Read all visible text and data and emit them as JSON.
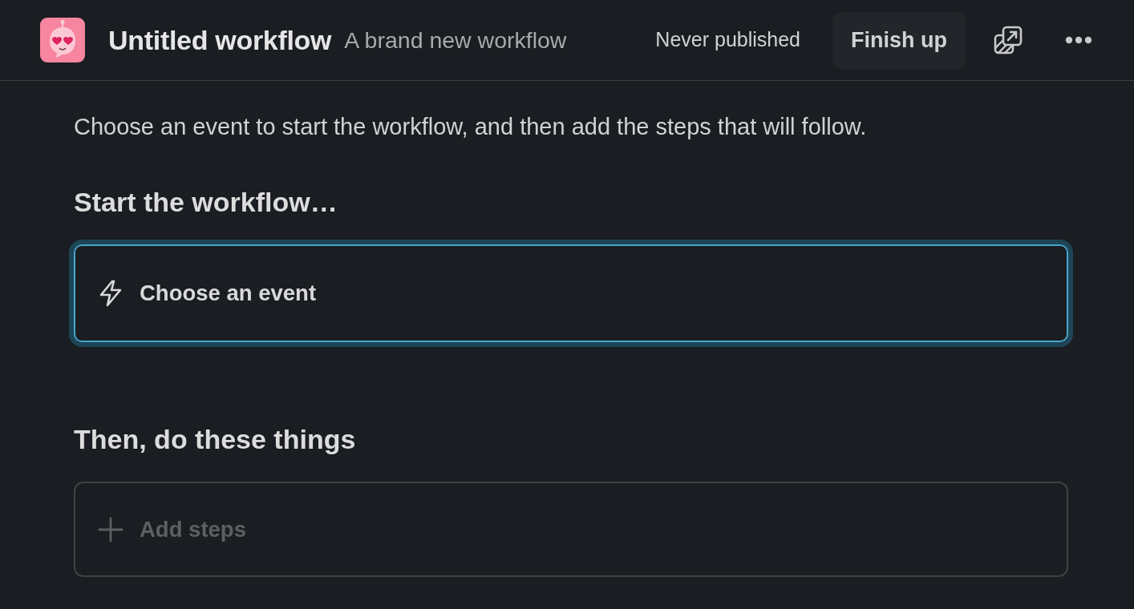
{
  "header": {
    "title": "Untitled workflow",
    "subtitle": "A brand new workflow",
    "status": "Never published",
    "primary_button": "Finish up"
  },
  "description": "Choose an event to start the workflow, and then add the steps that will follow.",
  "sections": [
    {
      "heading": "Start the workflow…",
      "slot": {
        "kind": "trigger",
        "label": "Choose an event",
        "focused": true,
        "disabled": false
      }
    },
    {
      "heading": "Then, do these things",
      "slot": {
        "kind": "steps",
        "label": "Add steps",
        "focused": false,
        "disabled": true
      }
    }
  ]
}
